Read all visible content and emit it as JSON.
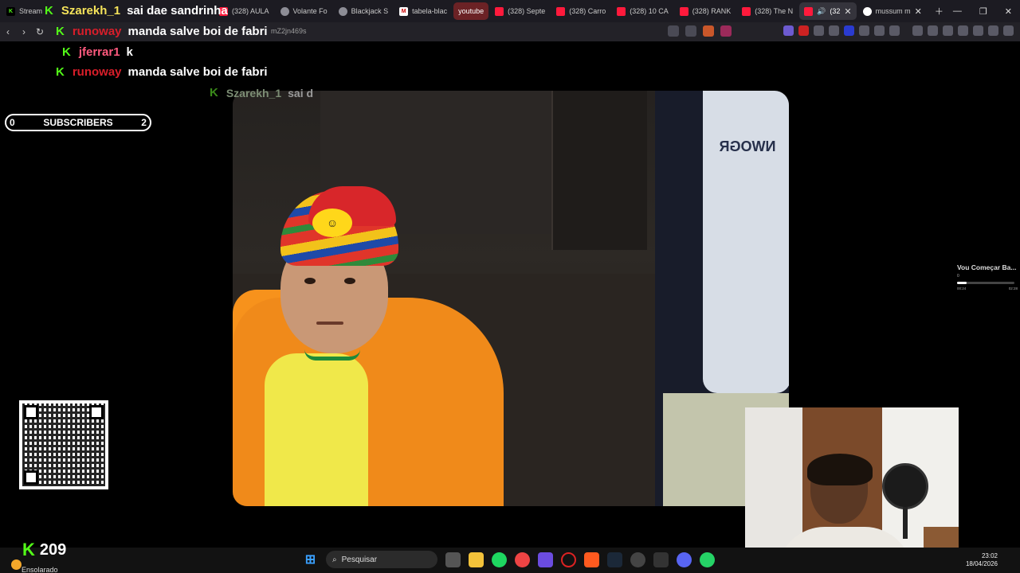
{
  "browser": {
    "tabs": [
      {
        "icon": "kick-icon",
        "label": "Stream",
        "type": "kick"
      },
      {
        "icon": "youtube-icon",
        "label": "(328) AULA",
        "type": "yt"
      },
      {
        "icon": "generic-icon",
        "label": "Volante Fo",
        "type": "gen"
      },
      {
        "icon": "generic-icon",
        "label": "Blackjack S",
        "type": "gen"
      },
      {
        "icon": "m-icon",
        "label": "tabela-blac",
        "type": "m"
      },
      {
        "icon": "",
        "label": "youtube",
        "type": "hl"
      },
      {
        "icon": "youtube-icon",
        "label": "(328) Septe",
        "type": "yt"
      },
      {
        "icon": "youtube-icon",
        "label": "(328) Carro",
        "type": "yt"
      },
      {
        "icon": "youtube-icon",
        "label": "(328) 10 CA",
        "type": "yt"
      },
      {
        "icon": "youtube-icon",
        "label": "(328) RANK",
        "type": "yt"
      },
      {
        "icon": "youtube-icon",
        "label": "(328) The N",
        "type": "yt"
      },
      {
        "icon": "youtube-icon",
        "label": "(32",
        "type": "active"
      },
      {
        "icon": "google-icon",
        "label": "mussum m",
        "type": "g"
      }
    ],
    "url": "mZ2jn469s"
  },
  "chat": [
    {
      "user": "Szarekh_1",
      "user_color": "yellow",
      "message": "sai dae sandrinha"
    },
    {
      "user": "runoway",
      "user_color": "red",
      "message": "manda salve boi de fabri"
    },
    {
      "user": "jferrar1",
      "user_color": "pink",
      "message": "k"
    },
    {
      "user": "runoway",
      "user_color": "red",
      "message": "manda salve boi de fabri"
    },
    {
      "user": "Szarekh_1",
      "user_color": "grey",
      "message": "sai d"
    }
  ],
  "subscribers": {
    "left": "0",
    "label": "SUBSCRIBERS",
    "right": "2"
  },
  "video": {
    "shirt_text": "NWOGR"
  },
  "player": {
    "title": "Vou Começar Ba...",
    "sub": "0",
    "time_current": "00:24",
    "time_total": "02:28",
    "progress": 0.16
  },
  "overlay": {
    "kick_count": "209"
  },
  "taskbar": {
    "weather": "Ensolarado",
    "search_placeholder": "Pesquisar",
    "time": "23:02",
    "date": "18/04/2026"
  },
  "colors": {
    "kick_green": "#53fc18",
    "youtube_red": "#ff1a3c",
    "orange_hoodie": "#f08a1a"
  }
}
